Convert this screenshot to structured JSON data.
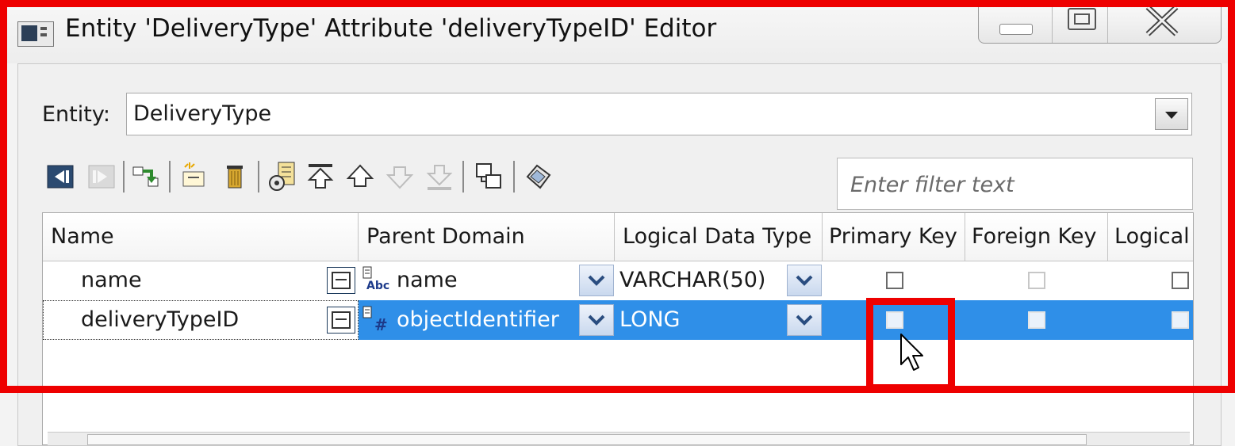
{
  "window": {
    "title": "Entity 'DeliveryType' Attribute 'deliveryTypeID' Editor"
  },
  "entity": {
    "label": "Entity:",
    "value": "DeliveryType"
  },
  "filter": {
    "placeholder": "Enter filter text"
  },
  "toolbar": {
    "icons": [
      "move-left-icon",
      "move-right-icon",
      "reorder-icon",
      "new-attribute-icon",
      "delete-icon",
      "properties-icon",
      "move-top-icon",
      "move-up-icon",
      "move-down-icon",
      "move-bottom-icon",
      "copy-icon",
      "tag-icon"
    ]
  },
  "grid": {
    "columns": [
      "Name",
      "Parent Domain",
      "Logical Data Type",
      "Primary Key",
      "Foreign Key",
      "Logical"
    ],
    "rows": [
      {
        "name": "name",
        "parent_domain": "name",
        "parent_domain_icon": "abc-domain-icon",
        "logical_data_type": "VARCHAR(50)",
        "primary_key": false,
        "foreign_key": false,
        "logical": false,
        "selected": false
      },
      {
        "name": "deliveryTypeID",
        "parent_domain": "objectIdentifier",
        "parent_domain_icon": "numeric-domain-icon",
        "logical_data_type": "LONG",
        "primary_key": false,
        "foreign_key": false,
        "logical": false,
        "selected": true
      }
    ]
  },
  "colors": {
    "selection": "#2f8fe8",
    "annotation": "#ee0000"
  }
}
